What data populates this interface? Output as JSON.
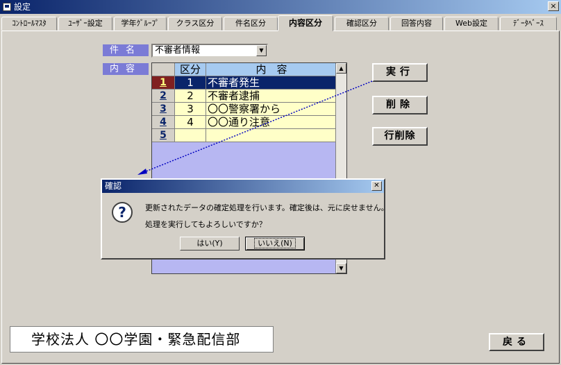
{
  "window": {
    "title": "設定",
    "close_label": "×"
  },
  "tabs": [
    "ｺﾝﾄﾛｰﾙﾏｽﾀ",
    "ﾕｰｻﾞｰ設定",
    "学年ｸﾞﾙｰﾌﾟ",
    "クラス区分",
    "件名区分",
    "内容区分",
    "確認区分",
    "回答内容",
    "Web設定",
    "ﾃﾞｰﾀﾍﾞｰｽ"
  ],
  "active_tab": "内容区分",
  "form": {
    "subject_label": "件名",
    "subject_value": "不審者情報",
    "content_label": "内容"
  },
  "grid": {
    "headers": {
      "kubun": "区分",
      "naiyou": "内　容"
    },
    "rows": [
      {
        "num": "1",
        "kubun": "1",
        "text": "不審者発生"
      },
      {
        "num": "2",
        "kubun": "2",
        "text": "不審者逮捕"
      },
      {
        "num": "3",
        "kubun": "3",
        "text": "〇〇警察署から"
      },
      {
        "num": "4",
        "kubun": "4",
        "text": "〇〇通り注意"
      },
      {
        "num": "5",
        "kubun": "",
        "text": ""
      }
    ],
    "selected_row": 1
  },
  "buttons": {
    "execute": "実行",
    "delete": "削除",
    "delete_row": "行削除",
    "back": "戻る"
  },
  "footer": {
    "org_name": "学校法人 〇〇学園・緊急配信部"
  },
  "dialog": {
    "title": "確認",
    "line1": "更新されたデータの確定処理を行います。確定後は、元に戻せません。",
    "line2": "処理を実行してもよろしいですか？",
    "yes_label": "はい(Y)",
    "no_label": "いいえ(N)"
  },
  "colors": {
    "titlebar": "#0a246a",
    "label_bg": "#7b7bd6",
    "grid_bg": "#b7b7f2",
    "cell_bg": "#ffffc8",
    "header_bg": "#a6caf0"
  }
}
